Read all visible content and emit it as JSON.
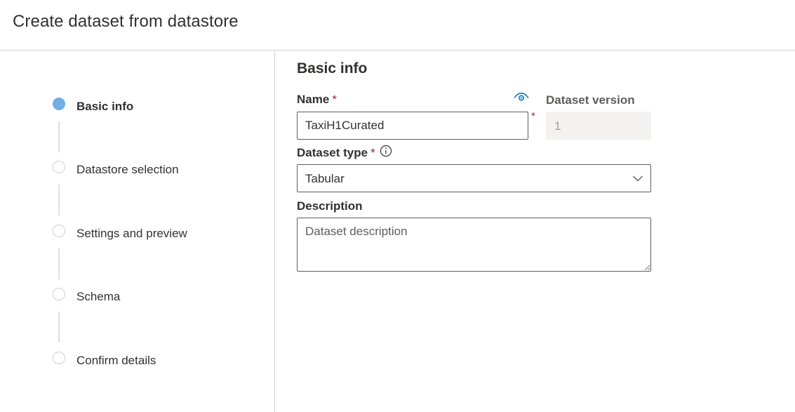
{
  "header": {
    "title": "Create dataset from datastore"
  },
  "wizard": {
    "steps": [
      {
        "label": "Basic info",
        "state": "active"
      },
      {
        "label": "Datastore selection",
        "state": "pending"
      },
      {
        "label": "Settings and preview",
        "state": "pending"
      },
      {
        "label": "Schema",
        "state": "pending"
      },
      {
        "label": "Confirm details",
        "state": "pending"
      }
    ]
  },
  "form": {
    "section_title": "Basic info",
    "name": {
      "label": "Name",
      "required_marker": "*",
      "value": "TaxiH1Curated",
      "icon": "eye-icon"
    },
    "dataset_version": {
      "label": "Dataset version",
      "value": "1"
    },
    "dataset_type": {
      "label": "Dataset type",
      "required_marker": "*",
      "selected": "Tabular",
      "icon": "info-icon"
    },
    "description": {
      "label": "Description",
      "placeholder": "Dataset description",
      "value": ""
    }
  },
  "colors": {
    "accent": "#0078d4",
    "active_step": "#71afe5",
    "required": "#a4262c",
    "border": "#605e5c",
    "divider": "#d2d0ce",
    "disabled_bg": "#f3f2f1"
  }
}
